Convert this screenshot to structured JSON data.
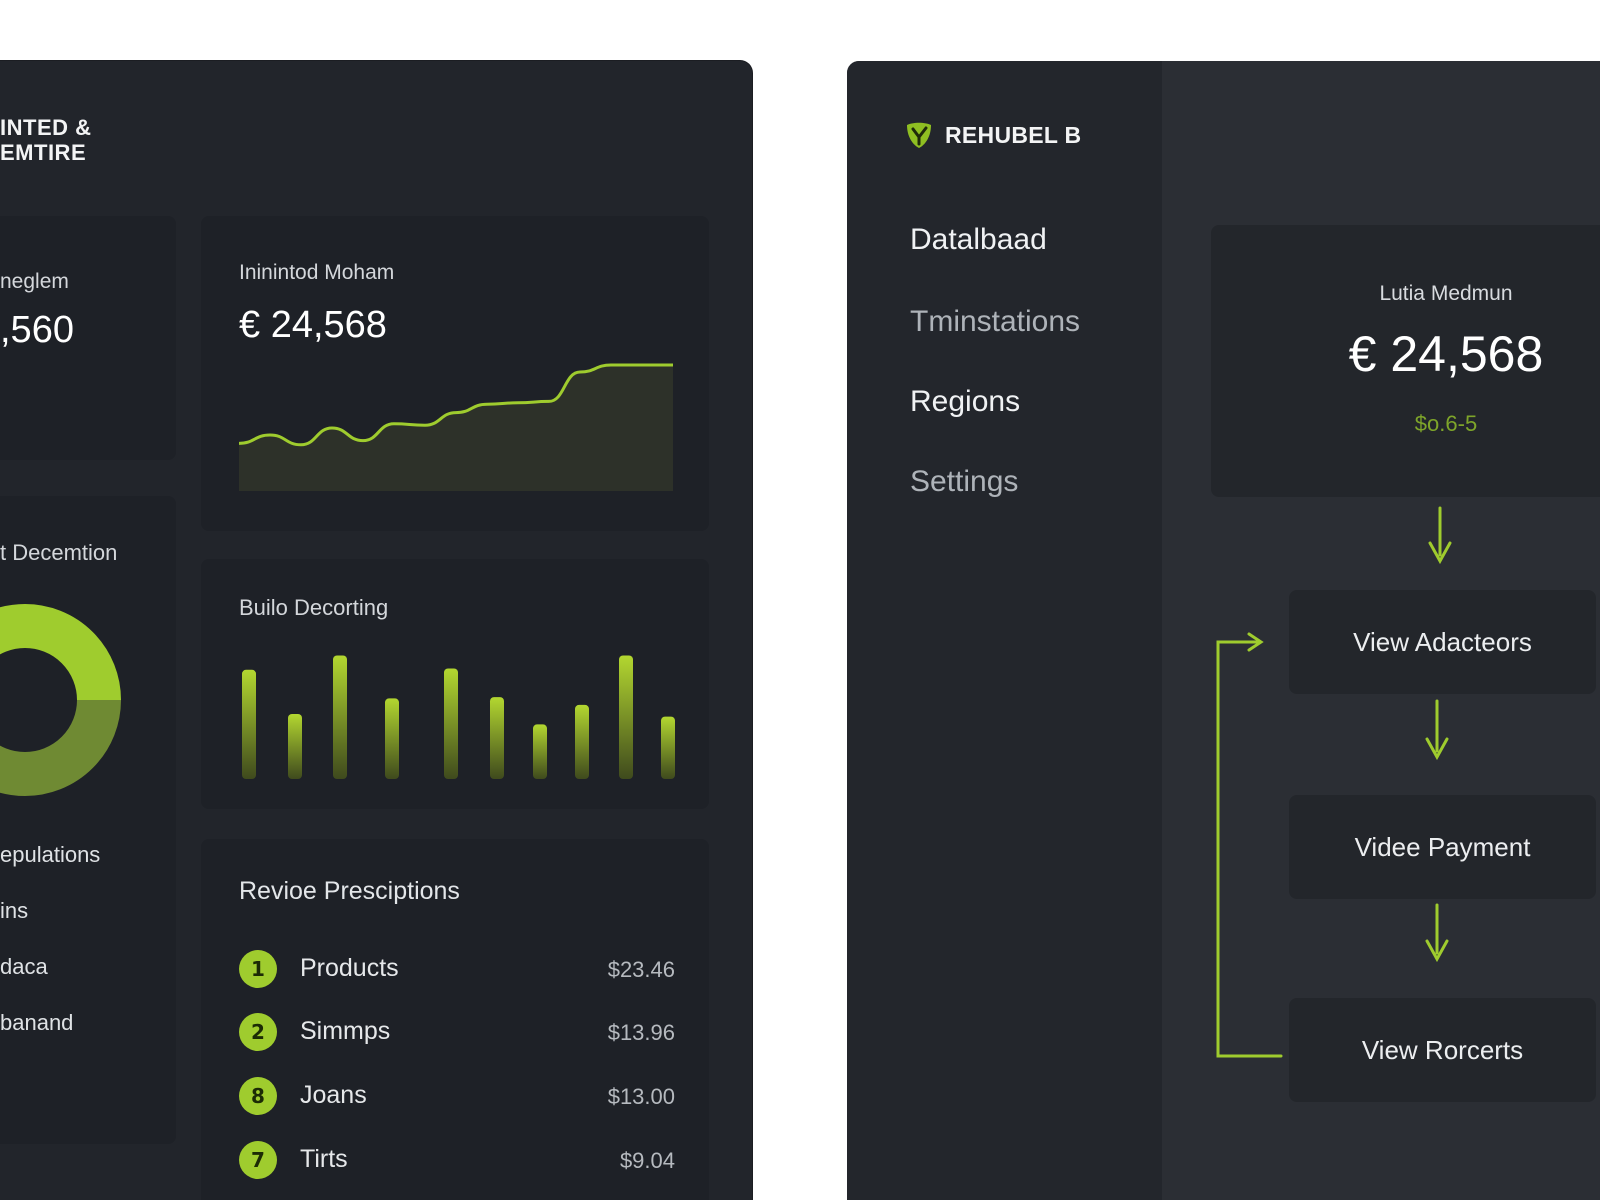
{
  "colors": {
    "accent": "#9fcc2e",
    "window_bg": "#22252b",
    "card_bg": "#1e2127",
    "sidebar_bg": "#23262c",
    "content_bg": "#2b2e34"
  },
  "left": {
    "brand": {
      "line1": "INTED &",
      "line2": "EMTIRE"
    },
    "kpi_partial": {
      "title": "neglem",
      "value": ",560"
    },
    "line_card": {
      "title": "Ininintod Moham",
      "value": "€ 24,568",
      "chart_data": {
        "type": "area",
        "x": [
          0,
          1,
          2,
          3,
          4,
          5,
          6,
          7,
          8,
          9,
          10,
          11,
          12,
          13,
          14
        ],
        "values": [
          34,
          40,
          33,
          45,
          36,
          48,
          47,
          56,
          62,
          63,
          64,
          85,
          90,
          90,
          90
        ]
      }
    },
    "donut_card": {
      "title": "t Decemtion",
      "legend_title": "epulations",
      "legend_items": [
        "ins",
        "daca",
        "banand"
      ],
      "chart_data": {
        "type": "pie",
        "values": [
          50,
          50
        ]
      }
    },
    "bar_card": {
      "title": "Builo Decorting",
      "chart_data": {
        "type": "bar",
        "values": [
          84,
          50,
          95,
          62,
          85,
          63,
          42,
          57,
          95,
          48
        ]
      }
    },
    "rank_card": {
      "title": "Revioe Presciptions",
      "rows": [
        {
          "rank": "1",
          "label": "Products",
          "amount": "$23.46"
        },
        {
          "rank": "2",
          "label": "Simmps",
          "amount": "$13.96"
        },
        {
          "rank": "8",
          "label": "Joans",
          "amount": "$13.00"
        },
        {
          "rank": "7",
          "label": "Tirts",
          "amount": "$9.04"
        }
      ]
    }
  },
  "right": {
    "brand": {
      "name": "REHUBEL B",
      "icon": "leaf-badge-icon"
    },
    "nav": [
      {
        "label": "Datalbaad",
        "active": true
      },
      {
        "label": "Tminstations",
        "active": false
      },
      {
        "label": "Regions",
        "active": true
      },
      {
        "label": "Settings",
        "active": false
      }
    ],
    "summary": {
      "title": "Lutia Medmun",
      "value": "€ 24,568",
      "sub": "$o.6-5"
    },
    "flow": [
      {
        "label": "View Adacteors"
      },
      {
        "label": "Videe Payment"
      },
      {
        "label": "View Rorcerts"
      }
    ]
  }
}
